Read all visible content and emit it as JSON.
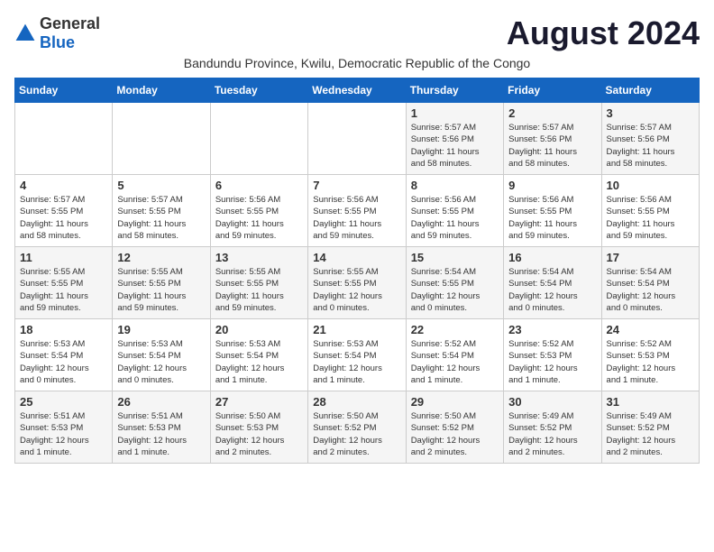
{
  "logo": {
    "general": "General",
    "blue": "Blue"
  },
  "title": "August 2024",
  "subtitle": "Bandundu Province, Kwilu, Democratic Republic of the Congo",
  "headers": [
    "Sunday",
    "Monday",
    "Tuesday",
    "Wednesday",
    "Thursday",
    "Friday",
    "Saturday"
  ],
  "weeks": [
    [
      {
        "day": "",
        "info": ""
      },
      {
        "day": "",
        "info": ""
      },
      {
        "day": "",
        "info": ""
      },
      {
        "day": "",
        "info": ""
      },
      {
        "day": "1",
        "info": "Sunrise: 5:57 AM\nSunset: 5:56 PM\nDaylight: 11 hours\nand 58 minutes."
      },
      {
        "day": "2",
        "info": "Sunrise: 5:57 AM\nSunset: 5:56 PM\nDaylight: 11 hours\nand 58 minutes."
      },
      {
        "day": "3",
        "info": "Sunrise: 5:57 AM\nSunset: 5:56 PM\nDaylight: 11 hours\nand 58 minutes."
      }
    ],
    [
      {
        "day": "4",
        "info": "Sunrise: 5:57 AM\nSunset: 5:55 PM\nDaylight: 11 hours\nand 58 minutes."
      },
      {
        "day": "5",
        "info": "Sunrise: 5:57 AM\nSunset: 5:55 PM\nDaylight: 11 hours\nand 58 minutes."
      },
      {
        "day": "6",
        "info": "Sunrise: 5:56 AM\nSunset: 5:55 PM\nDaylight: 11 hours\nand 59 minutes."
      },
      {
        "day": "7",
        "info": "Sunrise: 5:56 AM\nSunset: 5:55 PM\nDaylight: 11 hours\nand 59 minutes."
      },
      {
        "day": "8",
        "info": "Sunrise: 5:56 AM\nSunset: 5:55 PM\nDaylight: 11 hours\nand 59 minutes."
      },
      {
        "day": "9",
        "info": "Sunrise: 5:56 AM\nSunset: 5:55 PM\nDaylight: 11 hours\nand 59 minutes."
      },
      {
        "day": "10",
        "info": "Sunrise: 5:56 AM\nSunset: 5:55 PM\nDaylight: 11 hours\nand 59 minutes."
      }
    ],
    [
      {
        "day": "11",
        "info": "Sunrise: 5:55 AM\nSunset: 5:55 PM\nDaylight: 11 hours\nand 59 minutes."
      },
      {
        "day": "12",
        "info": "Sunrise: 5:55 AM\nSunset: 5:55 PM\nDaylight: 11 hours\nand 59 minutes."
      },
      {
        "day": "13",
        "info": "Sunrise: 5:55 AM\nSunset: 5:55 PM\nDaylight: 11 hours\nand 59 minutes."
      },
      {
        "day": "14",
        "info": "Sunrise: 5:55 AM\nSunset: 5:55 PM\nDaylight: 12 hours\nand 0 minutes."
      },
      {
        "day": "15",
        "info": "Sunrise: 5:54 AM\nSunset: 5:55 PM\nDaylight: 12 hours\nand 0 minutes."
      },
      {
        "day": "16",
        "info": "Sunrise: 5:54 AM\nSunset: 5:54 PM\nDaylight: 12 hours\nand 0 minutes."
      },
      {
        "day": "17",
        "info": "Sunrise: 5:54 AM\nSunset: 5:54 PM\nDaylight: 12 hours\nand 0 minutes."
      }
    ],
    [
      {
        "day": "18",
        "info": "Sunrise: 5:53 AM\nSunset: 5:54 PM\nDaylight: 12 hours\nand 0 minutes."
      },
      {
        "day": "19",
        "info": "Sunrise: 5:53 AM\nSunset: 5:54 PM\nDaylight: 12 hours\nand 0 minutes."
      },
      {
        "day": "20",
        "info": "Sunrise: 5:53 AM\nSunset: 5:54 PM\nDaylight: 12 hours\nand 1 minute."
      },
      {
        "day": "21",
        "info": "Sunrise: 5:53 AM\nSunset: 5:54 PM\nDaylight: 12 hours\nand 1 minute."
      },
      {
        "day": "22",
        "info": "Sunrise: 5:52 AM\nSunset: 5:54 PM\nDaylight: 12 hours\nand 1 minute."
      },
      {
        "day": "23",
        "info": "Sunrise: 5:52 AM\nSunset: 5:53 PM\nDaylight: 12 hours\nand 1 minute."
      },
      {
        "day": "24",
        "info": "Sunrise: 5:52 AM\nSunset: 5:53 PM\nDaylight: 12 hours\nand 1 minute."
      }
    ],
    [
      {
        "day": "25",
        "info": "Sunrise: 5:51 AM\nSunset: 5:53 PM\nDaylight: 12 hours\nand 1 minute."
      },
      {
        "day": "26",
        "info": "Sunrise: 5:51 AM\nSunset: 5:53 PM\nDaylight: 12 hours\nand 1 minute."
      },
      {
        "day": "27",
        "info": "Sunrise: 5:50 AM\nSunset: 5:53 PM\nDaylight: 12 hours\nand 2 minutes."
      },
      {
        "day": "28",
        "info": "Sunrise: 5:50 AM\nSunset: 5:52 PM\nDaylight: 12 hours\nand 2 minutes."
      },
      {
        "day": "29",
        "info": "Sunrise: 5:50 AM\nSunset: 5:52 PM\nDaylight: 12 hours\nand 2 minutes."
      },
      {
        "day": "30",
        "info": "Sunrise: 5:49 AM\nSunset: 5:52 PM\nDaylight: 12 hours\nand 2 minutes."
      },
      {
        "day": "31",
        "info": "Sunrise: 5:49 AM\nSunset: 5:52 PM\nDaylight: 12 hours\nand 2 minutes."
      }
    ]
  ]
}
